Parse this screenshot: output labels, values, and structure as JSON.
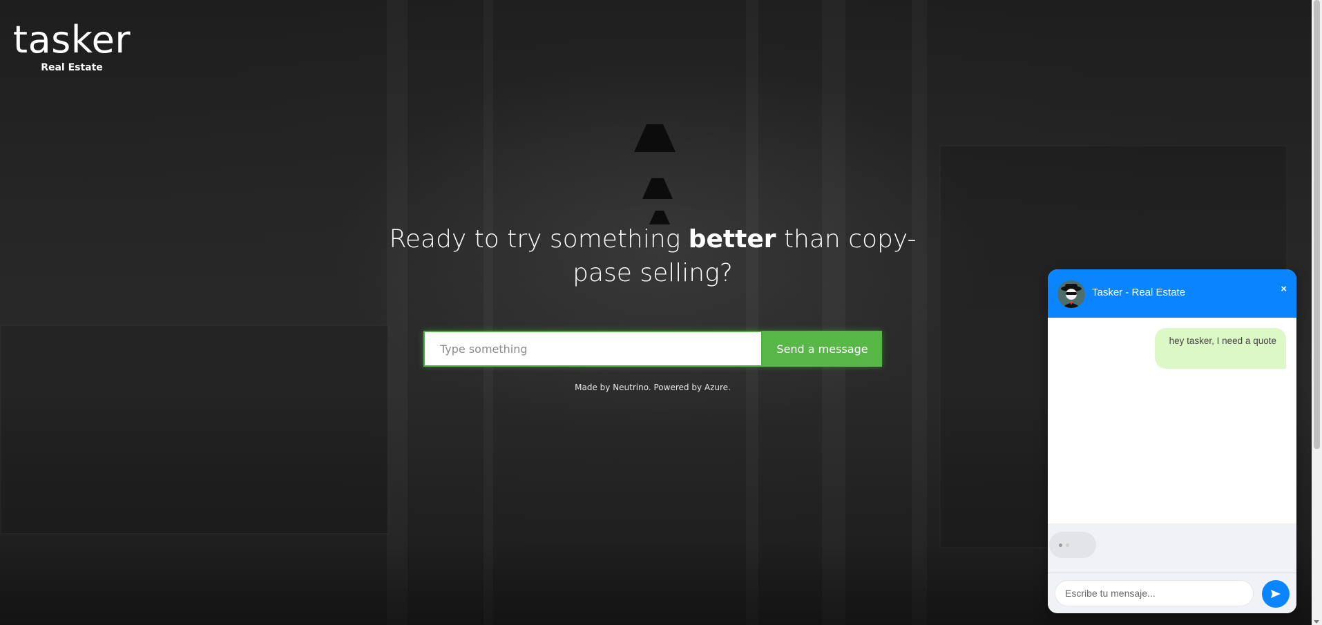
{
  "brand": {
    "logo_text": "tasker",
    "subtitle": "Real Estate"
  },
  "hero": {
    "title_part1": "Ready to try something ",
    "title_bold": "better",
    "title_part2": " than copy-pase selling?",
    "input_placeholder": "Type something",
    "input_value": "",
    "send_label": "Send a message",
    "credits": "Made by Neutrino. Powered by Azure."
  },
  "chat": {
    "title": "Tasker - Real Estate",
    "close_label": "×",
    "avatar_icon": "spy-avatar-icon",
    "messages": [
      {
        "from": "user",
        "text": "hey tasker, I need a quote"
      }
    ],
    "typing_indicator": true,
    "input_placeholder": "Escribe tu mensaje...",
    "send_icon": "send-arrow-icon",
    "colors": {
      "header": "#0a84ff",
      "user_bubble": "#dcf8c6",
      "send_button": "#0a84ff"
    }
  },
  "colors": {
    "accent_green": "#57b847",
    "page_text": "#ffffff"
  }
}
